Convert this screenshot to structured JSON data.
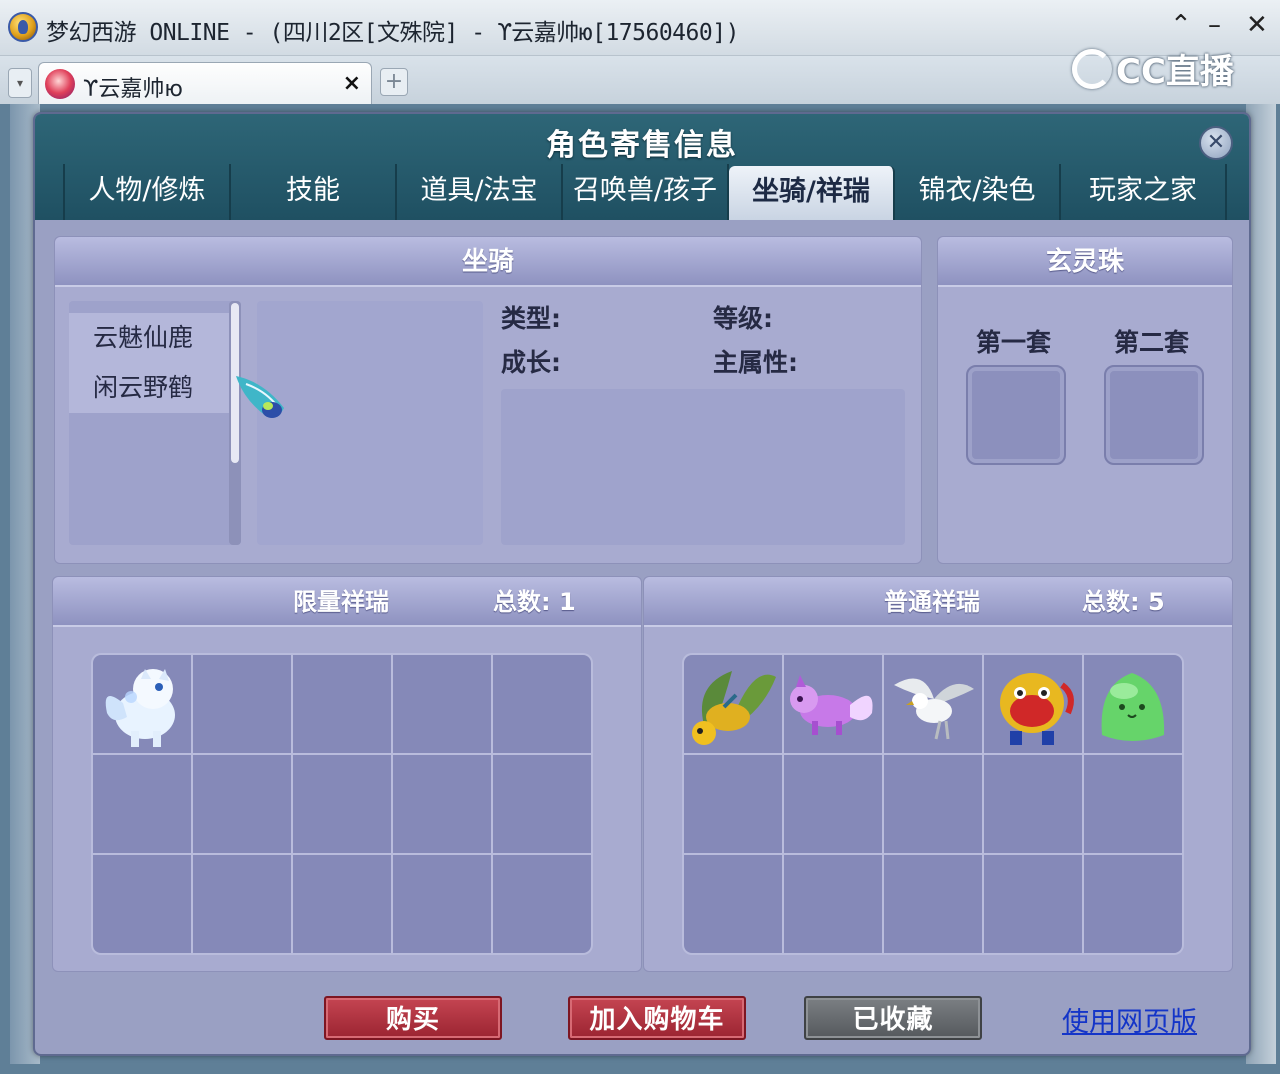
{
  "window": {
    "title": "梦幻西游 ONLINE - (四川2区[文殊院] - ϒ云嘉帅ю[17560460])",
    "controls": {
      "collapse": "⌃",
      "minimize": "–",
      "close": "✕"
    }
  },
  "browser": {
    "tab_label": "ϒ云嘉帅ю",
    "tab_close": "×",
    "tab_add": "+",
    "tab_dropdown": "▾",
    "watermark": "CC直播"
  },
  "dialog": {
    "title": "角色寄售信息",
    "close": "✕",
    "tabs": [
      {
        "label": "人物/修炼",
        "active": false
      },
      {
        "label": "技能",
        "active": false
      },
      {
        "label": "道具/法宝",
        "active": false
      },
      {
        "label": "召唤兽/孩子",
        "active": false
      },
      {
        "label": "坐骑/祥瑞",
        "active": true
      },
      {
        "label": "锦衣/染色",
        "active": false
      },
      {
        "label": "玩家之家",
        "active": false
      }
    ]
  },
  "mount": {
    "title": "坐骑",
    "list": [
      "云魅仙鹿",
      "闲云野鹤"
    ],
    "stats": {
      "type_label": "类型:",
      "level_label": "等级:",
      "growth_label": "成长:",
      "attr_label": "主属性:"
    }
  },
  "orb": {
    "title": "玄灵珠",
    "sets": [
      "第一套",
      "第二套"
    ]
  },
  "limited": {
    "title": "限量祥瑞",
    "count_label": "总数: 1",
    "items": [
      "white-fox-spirit"
    ]
  },
  "normal": {
    "title": "普通祥瑞",
    "count_label": "总数: 5",
    "items": [
      "golden-beetle",
      "purple-fox",
      "white-eagle",
      "red-lion-dance",
      "green-slime"
    ]
  },
  "actions": {
    "buy": "购买",
    "add_cart": "加入购物车",
    "favorited": "已收藏",
    "web_link": "使用网页版"
  },
  "colors": {
    "dialog_header": "#2e6677",
    "panel": "#a8abd0",
    "button_red": "#b03440",
    "button_gray": "#6a6e72",
    "link": "#1435c8"
  }
}
